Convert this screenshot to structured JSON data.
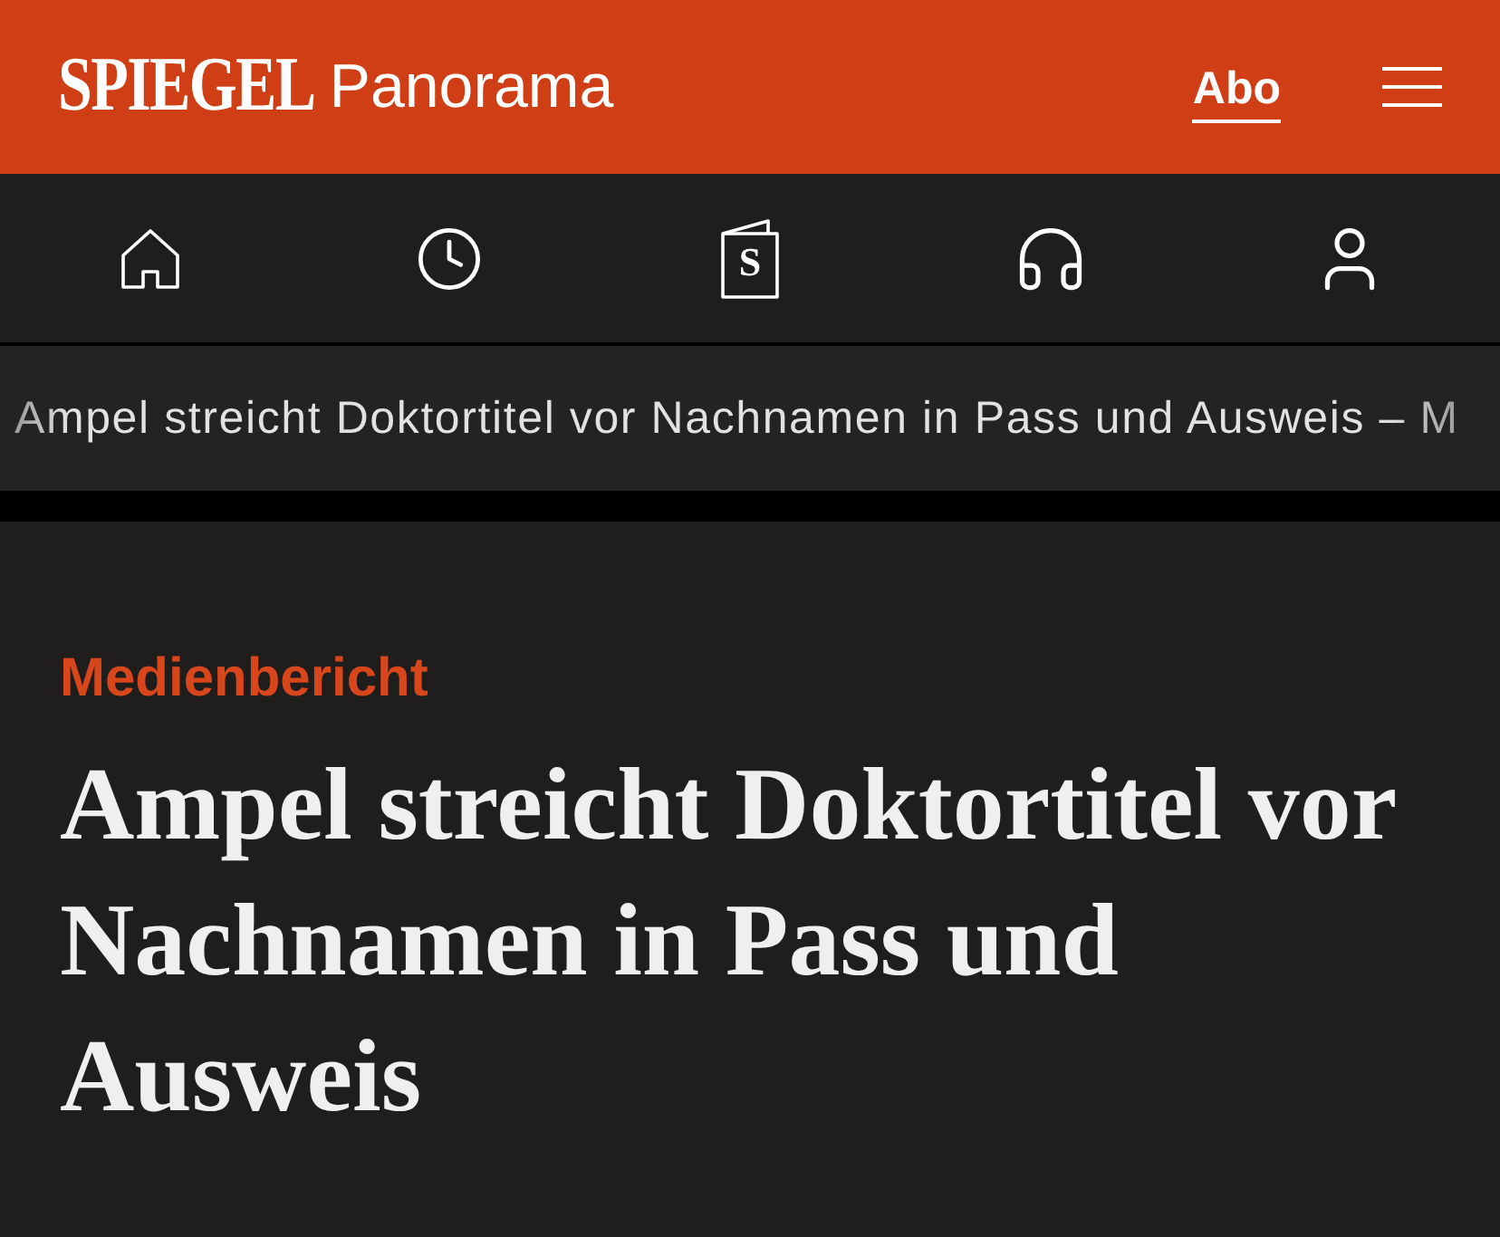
{
  "header": {
    "logo": "SPIEGEL",
    "section": "Panorama",
    "subscribe_link": "Abo"
  },
  "nav": {
    "edition_letter": "S"
  },
  "ticker": {
    "text": "Ampel streicht Doktortitel vor Nachnamen in Pass und Ausweis – M"
  },
  "article": {
    "kicker": "Medienbericht",
    "headline": "Ampel streicht Doktortitel vor Nachnamen in Pass und Ausweis"
  }
}
